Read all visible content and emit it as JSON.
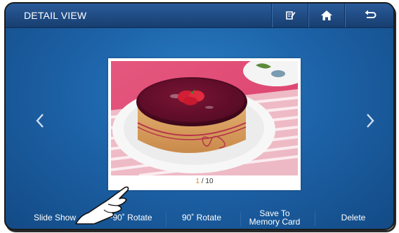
{
  "header": {
    "title": "DETAIL VIEW",
    "buttons": [
      {
        "name": "edit",
        "icon": "edit-note-icon"
      },
      {
        "name": "home",
        "icon": "home-icon"
      },
      {
        "name": "back",
        "icon": "return-arrow-icon"
      }
    ]
  },
  "viewer": {
    "current_index": "1",
    "total_label": " / 10",
    "photo_subject": "cake-photo",
    "prev_icon": "chevron-left-icon",
    "next_icon": "chevron-right-icon"
  },
  "footer": {
    "slide_show": "Slide Show",
    "rotate_left": "−90˚ Rotate",
    "rotate_right": "90˚ Rotate",
    "save_line1": "Save To",
    "save_line2": "Memory Card",
    "delete": "Delete"
  },
  "colors": {
    "header_bg": "#1f4a80",
    "background": "#1d63a8",
    "counter_accent": "#e88b1f",
    "text": "#ffffff"
  }
}
